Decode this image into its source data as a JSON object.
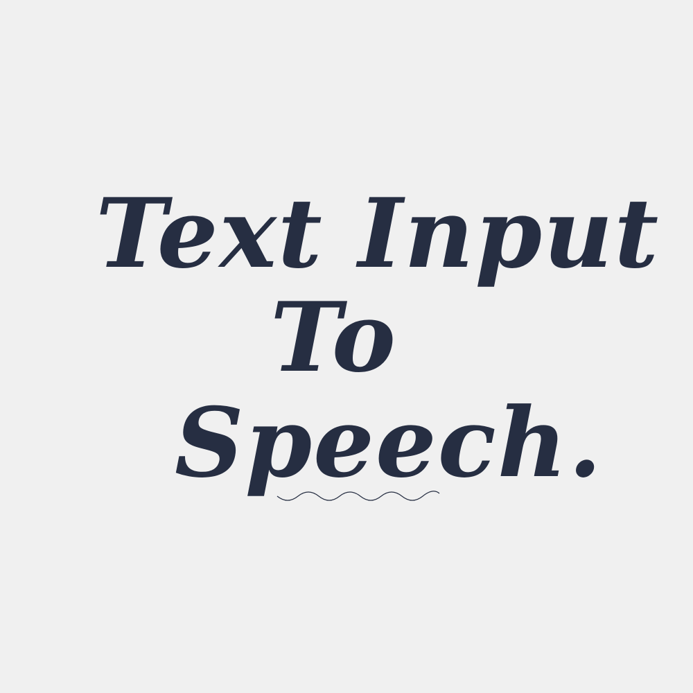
{
  "title": {
    "line1": "Text Input",
    "line2": "To",
    "line3": "Speech."
  },
  "colors": {
    "background": "#f0f0f0",
    "text": "#262e42",
    "squiggle": "#262e42"
  },
  "decorations": {
    "underline": "wavy-underline"
  }
}
